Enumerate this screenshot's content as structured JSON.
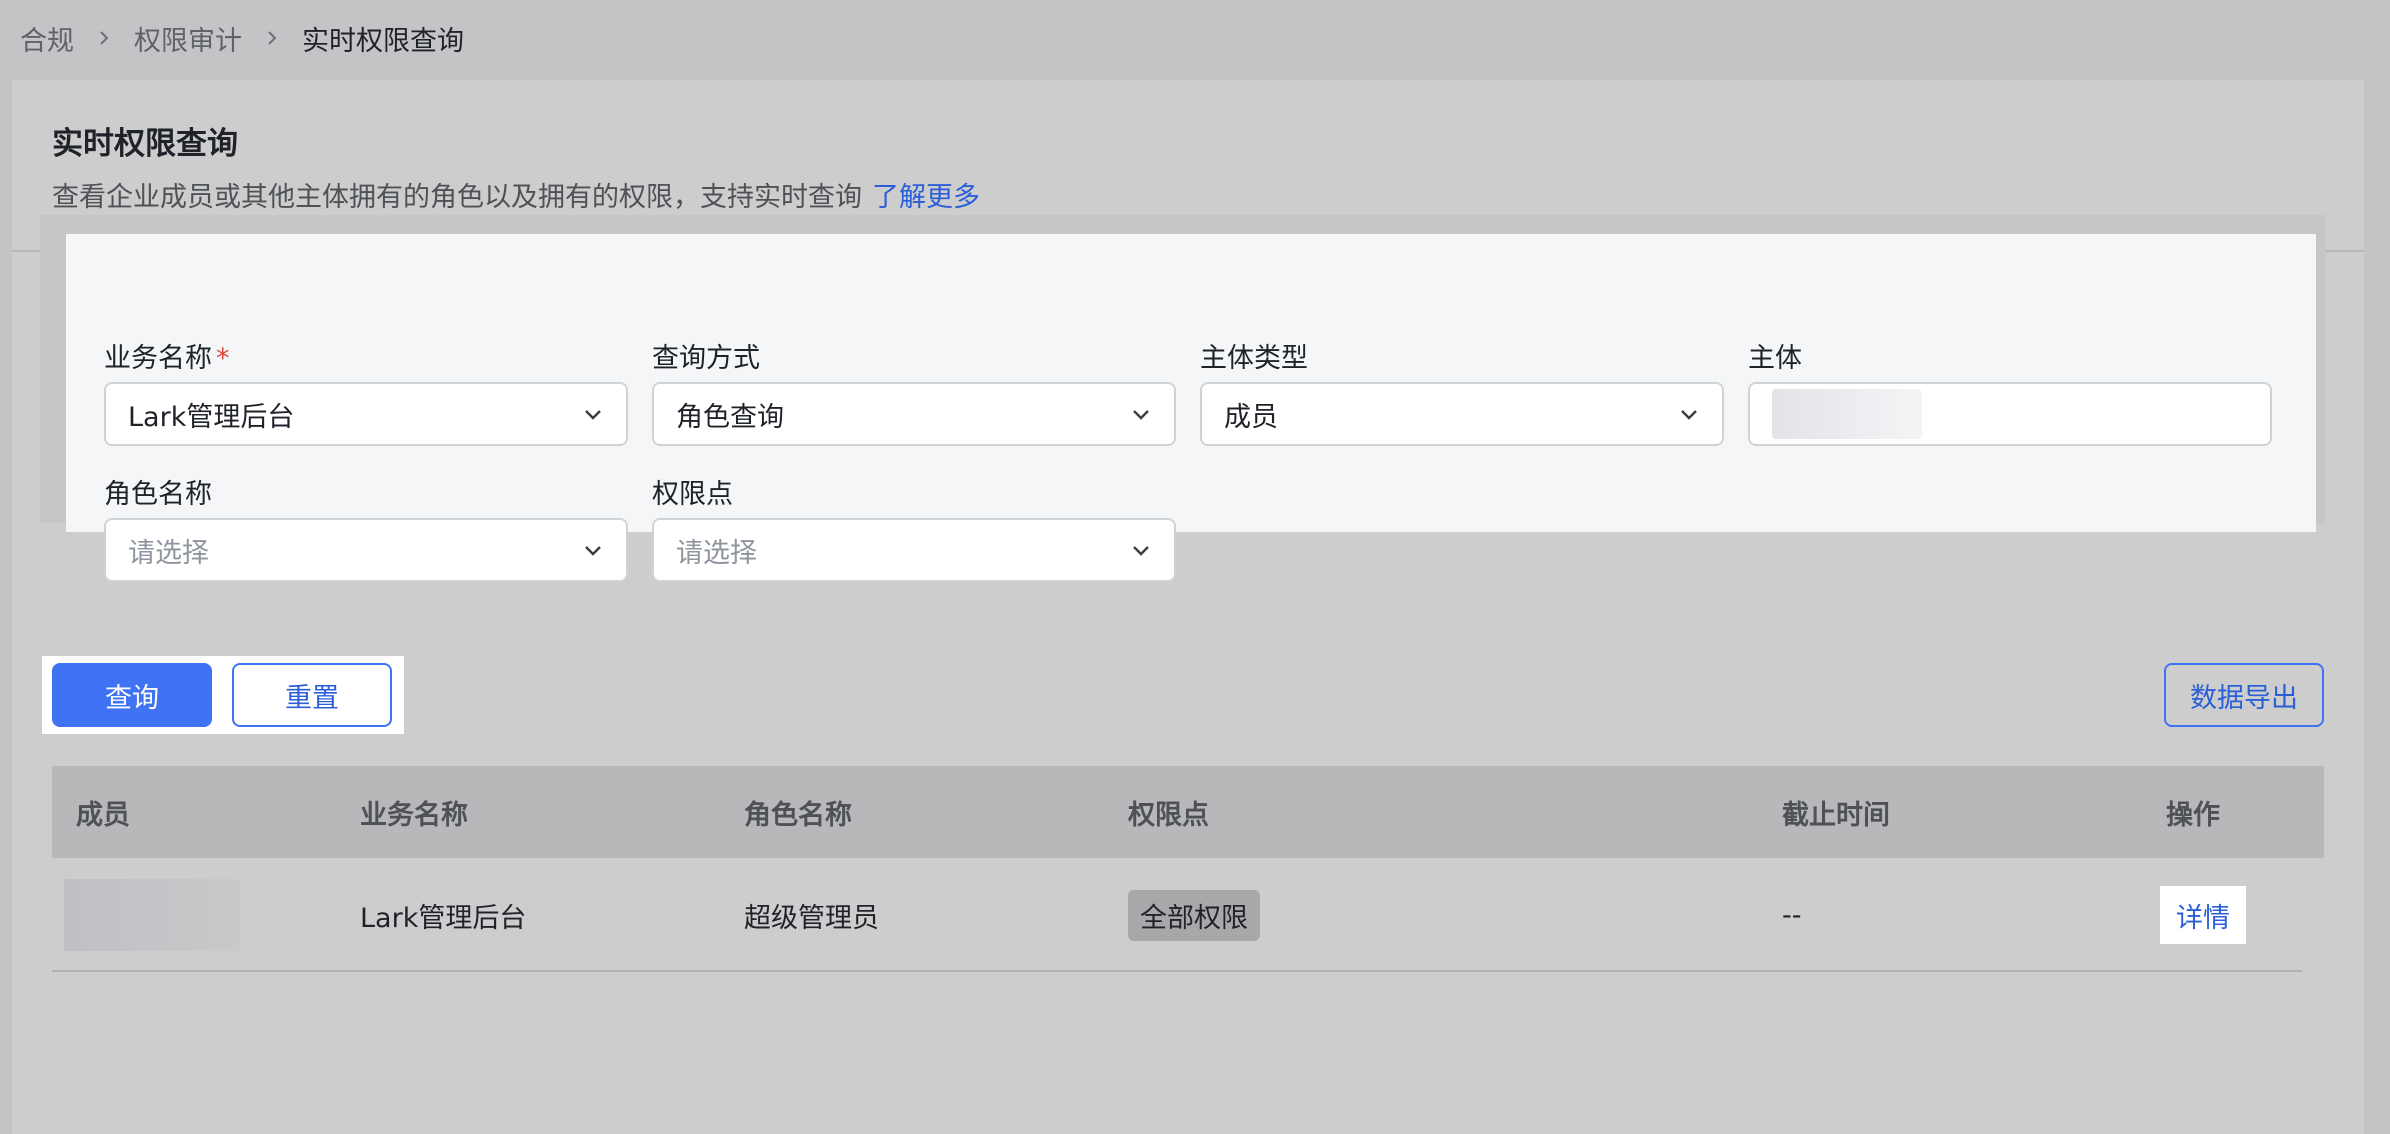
{
  "breadcrumb": {
    "items": [
      "合规",
      "权限审计",
      "实时权限查询"
    ]
  },
  "header": {
    "title": "实时权限查询",
    "description": "查看企业成员或其他主体拥有的角色以及拥有的权限，支持实时查询",
    "learn_more": "了解更多"
  },
  "filters": {
    "business": {
      "label": "业务名称",
      "required_mark": "*",
      "value": "Lark管理后台"
    },
    "query_mode": {
      "label": "查询方式",
      "value": "角色查询"
    },
    "subject_type": {
      "label": "主体类型",
      "value": "成员"
    },
    "subject": {
      "label": "主体"
    },
    "role_name": {
      "label": "角色名称",
      "placeholder": "请选择"
    },
    "permission": {
      "label": "权限点",
      "placeholder": "请选择"
    }
  },
  "actions": {
    "query": "查询",
    "reset": "重置",
    "export": "数据导出"
  },
  "table": {
    "columns": [
      "成员",
      "业务名称",
      "角色名称",
      "权限点",
      "截止时间",
      "操作"
    ],
    "rows": [
      {
        "business": "Lark管理后台",
        "role": "超级管理员",
        "permission": "全部权限",
        "deadline": "--",
        "action": "详情"
      }
    ]
  },
  "colors": {
    "primary": "#3f73f4",
    "link": "#2a5fd8",
    "required": "#e2463b"
  },
  "icons": [
    "chevron-right-icon",
    "chevron-down-icon"
  ]
}
